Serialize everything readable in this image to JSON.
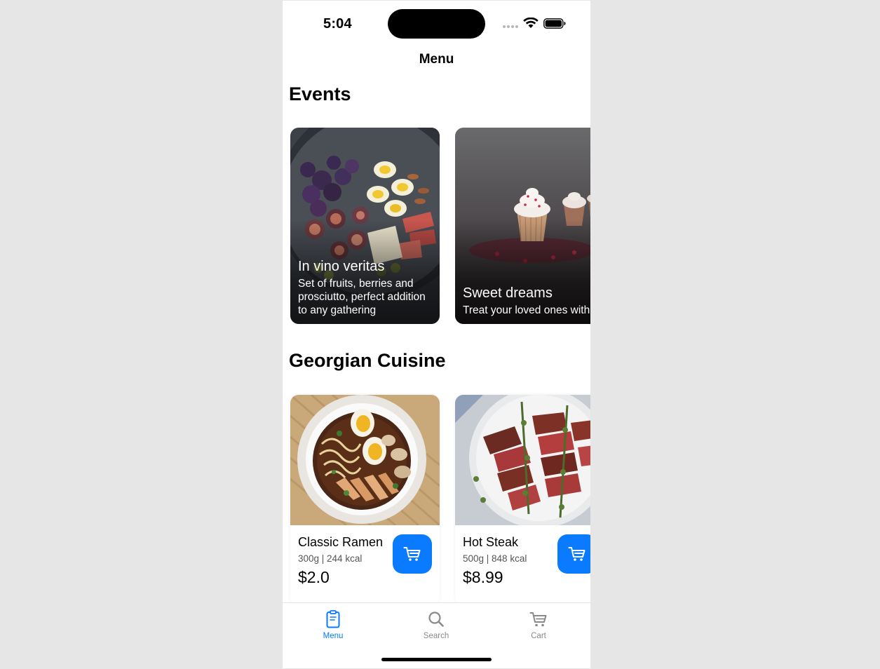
{
  "status": {
    "time": "5:04",
    "icons": [
      "signal-dots-icon",
      "wifi-icon",
      "battery-icon"
    ]
  },
  "nav": {
    "title": "Menu"
  },
  "events": {
    "title": "Events",
    "items": [
      {
        "name": "In vino veritas",
        "description": "Set of fruits, berries and prosciutto, perfect addition to any gathering"
      },
      {
        "name": "Sweet dreams",
        "description": "Treat your loved ones with your presence"
      }
    ]
  },
  "cuisine": {
    "title": "Georgian Cuisine",
    "items": [
      {
        "name": "Classic Ramen",
        "meta": "300g | 244 kcal",
        "price": "$2.0"
      },
      {
        "name": "Hot Steak",
        "meta": "500g | 848 kcal",
        "price": "$8.99"
      }
    ]
  },
  "tabbar": {
    "tabs": [
      {
        "label": "Menu",
        "icon": "menu-icon",
        "active": true
      },
      {
        "label": "Search",
        "icon": "search-icon",
        "active": false
      },
      {
        "label": "Cart",
        "icon": "cart-icon",
        "active": false
      }
    ]
  },
  "colors": {
    "accent": "#0a7aff",
    "inactive_tab": "#8a8a8a",
    "background": "#e6e6e6"
  }
}
